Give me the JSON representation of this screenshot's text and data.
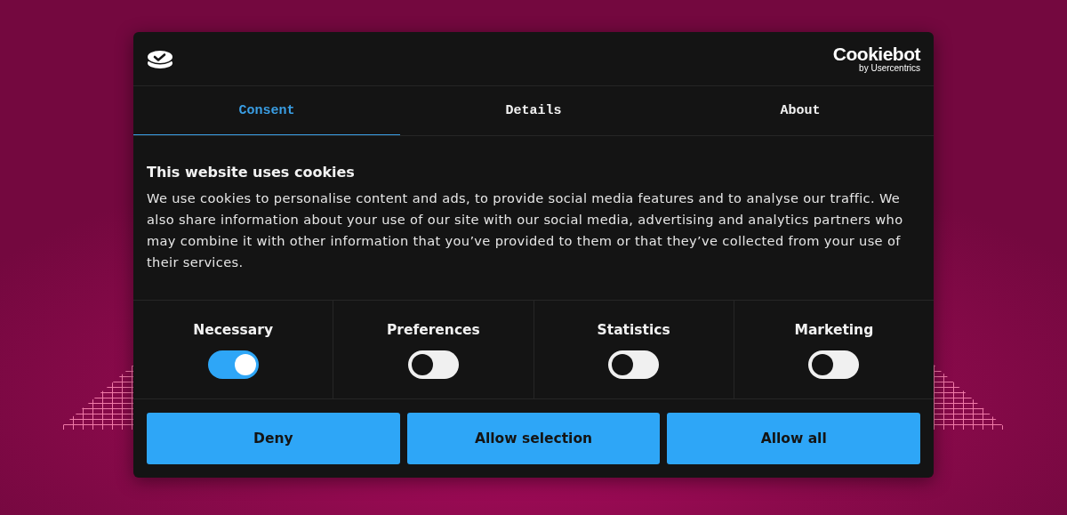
{
  "header": {
    "logo_title": "Cookiebot",
    "logo_subtitle": "by Usercentrics"
  },
  "tabs": [
    {
      "label": "Consent",
      "selected": true
    },
    {
      "label": "Details",
      "selected": false
    },
    {
      "label": "About",
      "selected": false
    }
  ],
  "consent": {
    "heading": "This website uses cookies",
    "text": "We use cookies to personalise content and ads, to provide social media features and to analyse our traffic. We also share information about your use of our site with our social media, advertising and analytics partners who may combine it with other information that you’ve provided to them or that they’ve collected from your use of their services."
  },
  "categories": [
    {
      "label": "Necessary",
      "on": true
    },
    {
      "label": "Preferences",
      "on": false
    },
    {
      "label": "Statistics",
      "on": false
    },
    {
      "label": "Marketing",
      "on": false
    }
  ],
  "buttons": [
    "Deny",
    "Allow selection",
    "Allow all"
  ]
}
